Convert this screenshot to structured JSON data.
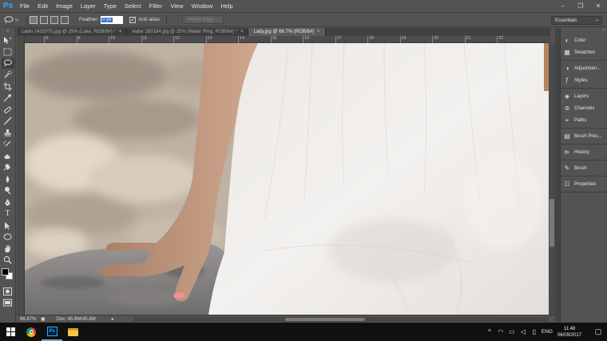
{
  "app": {
    "logo": "Ps",
    "menu": [
      "File",
      "Edit",
      "Image",
      "Layer",
      "Type",
      "Select",
      "Filter",
      "View",
      "Window",
      "Help"
    ],
    "window_controls": [
      "–",
      "❐",
      "✕"
    ]
  },
  "options": {
    "feather_label": "Feather:",
    "feather_value": "0 px",
    "antialias_label": "Anti-alias",
    "antialias_checked": true,
    "refine_edge_label": "Refine Edge...",
    "workspace": "Essentials"
  },
  "tabs": [
    {
      "label": "cabin 2432975.jpg @ 25% (Lake, RGB/8#) *",
      "active": false
    },
    {
      "label": "water 280184.jpg @ 25% (Water Ring, RGB/8#) *",
      "active": false
    },
    {
      "label": "Lady.jpg @ 66.7% (RGB/8#)",
      "active": true
    }
  ],
  "tab_close": "×",
  "ruler_top_labels": [
    "8",
    "9",
    "10",
    "11",
    "12",
    "13",
    "14",
    "15",
    "16",
    "17",
    "18",
    "19",
    "20",
    "21",
    "22"
  ],
  "status": {
    "zoom": "66.67%",
    "doc_size": "Doc: 45.8M/45.8M"
  },
  "panels": [
    {
      "group": 1,
      "items": [
        {
          "label": "Color",
          "icon": "color-wheel-icon"
        },
        {
          "label": "Swatches",
          "icon": "swatches-icon"
        }
      ]
    },
    {
      "group": 2,
      "items": [
        {
          "label": "Adjustmen...",
          "icon": "adjustments-icon"
        },
        {
          "label": "Styles",
          "icon": "styles-icon"
        }
      ]
    },
    {
      "group": 3,
      "items": [
        {
          "label": "Layers",
          "icon": "layers-icon"
        },
        {
          "label": "Channels",
          "icon": "channels-icon"
        },
        {
          "label": "Paths",
          "icon": "paths-icon"
        }
      ]
    },
    {
      "group": 4,
      "items": [
        {
          "label": "Brush Pres...",
          "icon": "brush-presets-icon"
        }
      ]
    },
    {
      "group": 5,
      "items": [
        {
          "label": "History",
          "icon": "history-icon"
        }
      ]
    },
    {
      "group": 6,
      "items": [
        {
          "label": "Brush",
          "icon": "brush-icon"
        }
      ]
    },
    {
      "group": 7,
      "items": [
        {
          "label": "Properties",
          "icon": "properties-icon"
        }
      ]
    }
  ],
  "taskbar": {
    "language": "ENG",
    "time": "11:48",
    "date": "06/09/2017"
  },
  "colors": {
    "ui_bg": "#535353",
    "foreground_color": "#000000",
    "background_color": "#ffffff",
    "selection_highlight": "#2f6fd6"
  }
}
